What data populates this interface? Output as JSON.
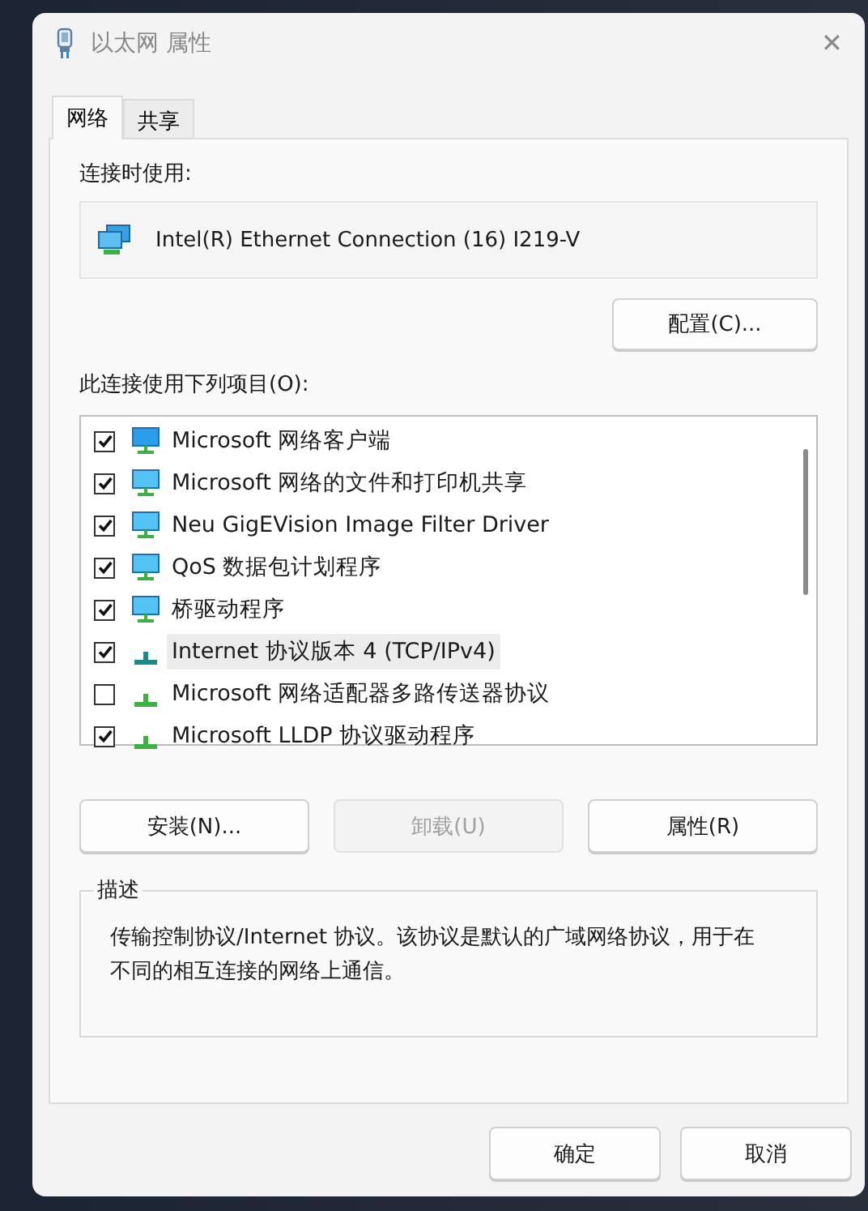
{
  "window": {
    "title": "以太网 属性",
    "close": "✕"
  },
  "tabs": [
    {
      "label": "网络",
      "selected": true
    },
    {
      "label": "共享",
      "selected": false
    }
  ],
  "connect_using": {
    "label": "连接时使用:",
    "adapter": "Intel(R) Ethernet Connection (16) I219-V"
  },
  "configure_button": "配置(C)...",
  "items_label": "此连接使用下列项目(O):",
  "items": [
    {
      "kind": "client",
      "label": "Microsoft 网络客户端",
      "checked": true,
      "selected": false
    },
    {
      "kind": "service",
      "label": "Microsoft 网络的文件和打印机共享",
      "checked": true,
      "selected": false
    },
    {
      "kind": "service",
      "label": "Neu GigEVision Image Filter Driver",
      "checked": true,
      "selected": false
    },
    {
      "kind": "service",
      "label": "QoS 数据包计划程序",
      "checked": true,
      "selected": false
    },
    {
      "kind": "service",
      "label": "桥驱动程序",
      "checked": true,
      "selected": false
    },
    {
      "kind": "protocol",
      "label": "Internet 协议版本 4 (TCP/IPv4)",
      "checked": true,
      "selected": true
    },
    {
      "kind": "protocol",
      "label": "Microsoft 网络适配器多路传送器协议",
      "checked": false,
      "selected": false
    },
    {
      "kind": "protocol",
      "label": "Microsoft LLDP 协议驱动程序",
      "checked": true,
      "selected": false
    }
  ],
  "item_buttons": [
    {
      "label": "安装(N)...",
      "disabled": false
    },
    {
      "label": "卸载(U)",
      "disabled": true
    },
    {
      "label": "属性(R)",
      "disabled": false
    }
  ],
  "description": {
    "title": "描述",
    "text": "传输控制协议/Internet 协议。该协议是默认的广域网络协议，用于在不同的相互连接的网络上通信。"
  },
  "buttons": [
    "确定",
    "取消"
  ]
}
